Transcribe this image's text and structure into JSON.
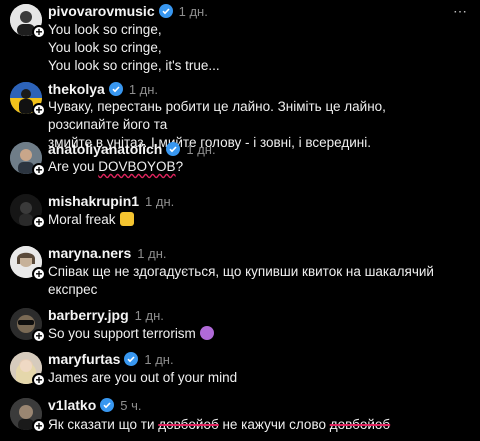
{
  "comments": [
    {
      "user": "pivovarovmusic",
      "verified": true,
      "time": "1 дн.",
      "lines": [
        "You look so cringe,",
        "You look so cringe,",
        "You look so cringe, it's true..."
      ]
    },
    {
      "user": "thekolya",
      "verified": true,
      "time": "1 дн.",
      "lines": [
        "Чуваку, перестань робити це лайно. Зніміть це лайно, розсипайте його та",
        "змийте в унітаз. І мийте голову - і зовні, і всередині."
      ]
    },
    {
      "user": "anatoliyanatolich",
      "verified": true,
      "time": "1 дн.",
      "text_pre": "Are you ",
      "text_mark": "DOVBOYOB",
      "text_post": "?"
    },
    {
      "user": "mishakrupin1",
      "verified": false,
      "time": "1 дн.",
      "text": "Moral freak",
      "emoji": "crying-face-emoji"
    },
    {
      "user": "maryna.ners",
      "verified": false,
      "time": "1 дн.",
      "lines": [
        "Співак ще не здогадується, що купивши квиток на шакалячий",
        "експрес"
      ]
    },
    {
      "user": "barberry.jpg",
      "verified": false,
      "time": "1 дн.",
      "text": "So you support terrorism",
      "emoji": "devil-face-emoji"
    },
    {
      "user": "maryfurtas",
      "verified": true,
      "time": "1 дн.",
      "text": "James are you out of your mind"
    },
    {
      "user": "v1latko",
      "verified": true,
      "time": "5 ч.",
      "text_a": "Як сказати що ти ",
      "strike_a": "довбойоб",
      "text_b": " не кажучи слово ",
      "strike_b": "довбойоб"
    }
  ],
  "colors": {
    "background": "#000000",
    "verified": "#3897f0",
    "time": "#8e8e8e",
    "mark": "#e0245e"
  }
}
